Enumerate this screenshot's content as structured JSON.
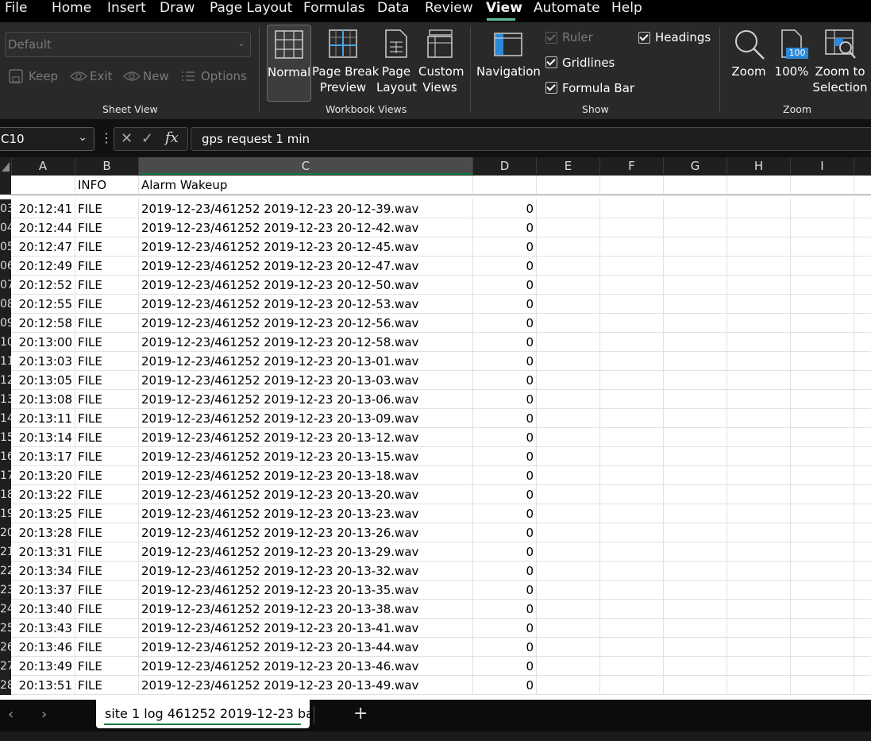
{
  "menu": {
    "items": [
      "File",
      "Home",
      "Insert",
      "Draw",
      "Page Layout",
      "Formulas",
      "Data",
      "Review",
      "View",
      "Automate",
      "Help"
    ],
    "active": "View"
  },
  "ribbon": {
    "sheet_view": {
      "dropdown_value": "Default",
      "keep": "Keep",
      "exit": "Exit",
      "new": "New",
      "options": "Options",
      "label": "Sheet View"
    },
    "workbook_views": {
      "normal": "Normal",
      "page_break_1": "Page Break",
      "page_break_2": "Preview",
      "page_layout_1": "Page",
      "page_layout_2": "Layout",
      "custom_1": "Custom",
      "custom_2": "Views",
      "label": "Workbook Views"
    },
    "show": {
      "navigation": "Navigation",
      "ruler": "Ruler",
      "gridlines": "Gridlines",
      "formula_bar": "Formula Bar",
      "headings": "Headings",
      "label": "Show"
    },
    "zoom": {
      "zoom": "Zoom",
      "hundred": "100%",
      "badge": "100",
      "zoom_to_1": "Zoom to",
      "zoom_to_2": "Selection",
      "label": "Zoom"
    }
  },
  "formula_bar": {
    "name_box": "C10",
    "fx": "fx",
    "content": "gps request 1 min"
  },
  "columns": [
    "A",
    "B",
    "C",
    "D",
    "E",
    "F",
    "G",
    "H",
    "I"
  ],
  "header_row": {
    "b": "INFO",
    "c": "Alarm Wakeup"
  },
  "rows": [
    {
      "rn": "03",
      "a": "20:12:41",
      "b": "FILE",
      "c": "2019-12-23/461252 2019-12-23 20-12-39.wav",
      "d": "0"
    },
    {
      "rn": "04",
      "a": "20:12:44",
      "b": "FILE",
      "c": "2019-12-23/461252 2019-12-23 20-12-42.wav",
      "d": "0"
    },
    {
      "rn": "05",
      "a": "20:12:47",
      "b": "FILE",
      "c": "2019-12-23/461252 2019-12-23 20-12-45.wav",
      "d": "0"
    },
    {
      "rn": "06",
      "a": "20:12:49",
      "b": "FILE",
      "c": "2019-12-23/461252 2019-12-23 20-12-47.wav",
      "d": "0"
    },
    {
      "rn": "07",
      "a": "20:12:52",
      "b": "FILE",
      "c": "2019-12-23/461252 2019-12-23 20-12-50.wav",
      "d": "0"
    },
    {
      "rn": "08",
      "a": "20:12:55",
      "b": "FILE",
      "c": "2019-12-23/461252 2019-12-23 20-12-53.wav",
      "d": "0"
    },
    {
      "rn": "09",
      "a": "20:12:58",
      "b": "FILE",
      "c": "2019-12-23/461252 2019-12-23 20-12-56.wav",
      "d": "0"
    },
    {
      "rn": "10",
      "a": "20:13:00",
      "b": "FILE",
      "c": "2019-12-23/461252 2019-12-23 20-12-58.wav",
      "d": "0"
    },
    {
      "rn": "11",
      "a": "20:13:03",
      "b": "FILE",
      "c": "2019-12-23/461252 2019-12-23 20-13-01.wav",
      "d": "0"
    },
    {
      "rn": "12",
      "a": "20:13:05",
      "b": "FILE",
      "c": "2019-12-23/461252 2019-12-23 20-13-03.wav",
      "d": "0"
    },
    {
      "rn": "13",
      "a": "20:13:08",
      "b": "FILE",
      "c": "2019-12-23/461252 2019-12-23 20-13-06.wav",
      "d": "0"
    },
    {
      "rn": "14",
      "a": "20:13:11",
      "b": "FILE",
      "c": "2019-12-23/461252 2019-12-23 20-13-09.wav",
      "d": "0"
    },
    {
      "rn": "15",
      "a": "20:13:14",
      "b": "FILE",
      "c": "2019-12-23/461252 2019-12-23 20-13-12.wav",
      "d": "0"
    },
    {
      "rn": "16",
      "a": "20:13:17",
      "b": "FILE",
      "c": "2019-12-23/461252 2019-12-23 20-13-15.wav",
      "d": "0"
    },
    {
      "rn": "17",
      "a": "20:13:20",
      "b": "FILE",
      "c": "2019-12-23/461252 2019-12-23 20-13-18.wav",
      "d": "0"
    },
    {
      "rn": "18",
      "a": "20:13:22",
      "b": "FILE",
      "c": "2019-12-23/461252 2019-12-23 20-13-20.wav",
      "d": "0"
    },
    {
      "rn": "19",
      "a": "20:13:25",
      "b": "FILE",
      "c": "2019-12-23/461252 2019-12-23 20-13-23.wav",
      "d": "0"
    },
    {
      "rn": "20",
      "a": "20:13:28",
      "b": "FILE",
      "c": "2019-12-23/461252 2019-12-23 20-13-26.wav",
      "d": "0"
    },
    {
      "rn": "21",
      "a": "20:13:31",
      "b": "FILE",
      "c": "2019-12-23/461252 2019-12-23 20-13-29.wav",
      "d": "0"
    },
    {
      "rn": "22",
      "a": "20:13:34",
      "b": "FILE",
      "c": "2019-12-23/461252 2019-12-23 20-13-32.wav",
      "d": "0"
    },
    {
      "rn": "23",
      "a": "20:13:37",
      "b": "FILE",
      "c": "2019-12-23/461252 2019-12-23 20-13-35.wav",
      "d": "0"
    },
    {
      "rn": "24",
      "a": "20:13:40",
      "b": "FILE",
      "c": "2019-12-23/461252 2019-12-23 20-13-38.wav",
      "d": "0"
    },
    {
      "rn": "25",
      "a": "20:13:43",
      "b": "FILE",
      "c": "2019-12-23/461252 2019-12-23 20-13-41.wav",
      "d": "0"
    },
    {
      "rn": "26",
      "a": "20:13:46",
      "b": "FILE",
      "c": "2019-12-23/461252 2019-12-23 20-13-44.wav",
      "d": "0"
    },
    {
      "rn": "27",
      "a": "20:13:49",
      "b": "FILE",
      "c": "2019-12-23/461252 2019-12-23 20-13-46.wav",
      "d": "0"
    },
    {
      "rn": "28",
      "a": "20:13:51",
      "b": "FILE",
      "c": "2019-12-23/461252 2019-12-23 20-13-49.wav",
      "d": "0"
    }
  ],
  "sheet_tabs": {
    "active_tab": "site 1 log 461252 2019-12-23 ba",
    "add_symbol": "+"
  },
  "colors": {
    "accent": "#107c41",
    "menu_underline": "#5fc09f",
    "ribbon_bg": "#292929",
    "grid_line": "#e1e1e1"
  }
}
